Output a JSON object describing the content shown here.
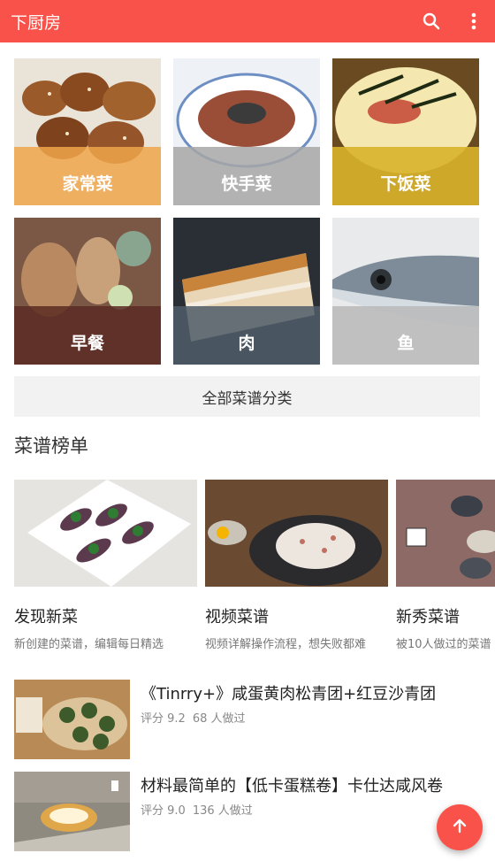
{
  "appbar": {
    "title": "下厨房",
    "search_icon": "search-icon",
    "more_icon": "more-vertical-icon",
    "color": "#f8524a"
  },
  "categories": [
    {
      "label": "家常菜",
      "color": "#f0a64b"
    },
    {
      "label": "快手菜",
      "color": "#a7a7a7"
    },
    {
      "label": "下饭菜",
      "color": "#d8b32a"
    },
    {
      "label": "早餐",
      "color": "#5a2a23"
    },
    {
      "label": "肉",
      "color": "#4f5d6a"
    },
    {
      "label": "鱼",
      "color": "#b9b9b9"
    }
  ],
  "all_categories_label": "全部菜谱分类",
  "ranking": {
    "title": "菜谱榜单",
    "items": [
      {
        "name": "发现新菜",
        "desc": "新创建的菜谱，编辑每日精选"
      },
      {
        "name": "视频菜谱",
        "desc": "视频详解操作流程，想失败都难"
      },
      {
        "name": "新秀菜谱",
        "desc": "被10人做过的菜谱"
      }
    ]
  },
  "recipes": [
    {
      "title": "《Tinrry+》咸蛋黄肉松青团+红豆沙青团",
      "rating": "评分 9.2",
      "made": "68 人做过"
    },
    {
      "title": "材料最简单的【低卡蛋糕卷】卡仕达咸风卷",
      "rating": "评分 9.0",
      "made": "136 人做过"
    }
  ],
  "fab": {
    "icon": "arrow-up-icon"
  }
}
